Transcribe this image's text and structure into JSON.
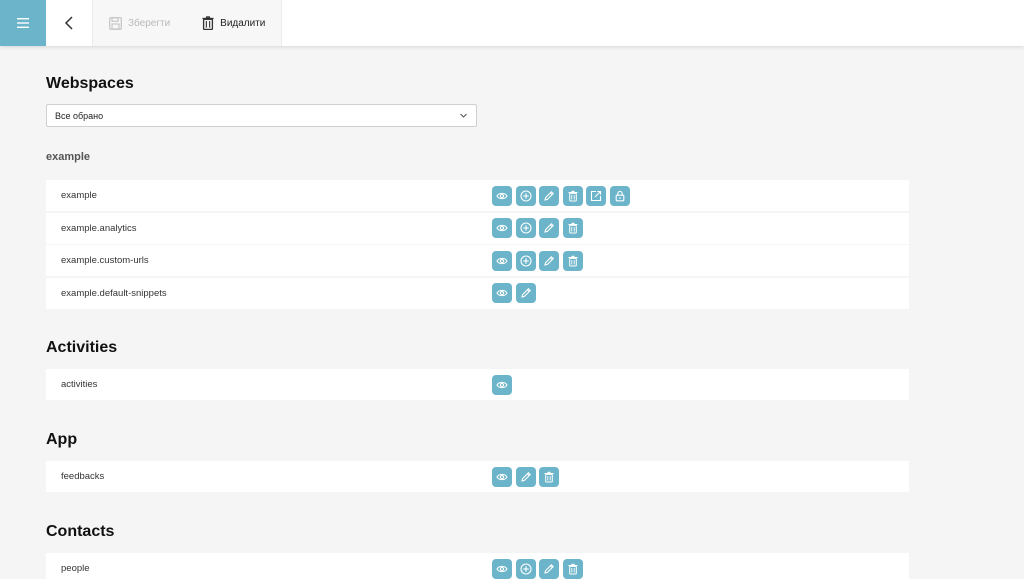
{
  "toolbar": {
    "save_label": "Зберегти",
    "delete_label": "Видалити"
  },
  "colors": {
    "accent": "#6cb4c9",
    "background": "#f5f5f5"
  },
  "webspaces": {
    "title": "Webspaces",
    "select_value": "Все обрано",
    "group_title": "example",
    "rows": [
      {
        "label": "example",
        "icons": [
          "eye-icon",
          "plus-circle-icon",
          "pencil-icon",
          "trash-icon",
          "export-icon",
          "lock-icon"
        ]
      },
      {
        "label": "example.analytics",
        "icons": [
          "eye-icon",
          "plus-circle-icon",
          "pencil-icon",
          "trash-icon"
        ]
      },
      {
        "label": "example.custom-urls",
        "icons": [
          "eye-icon",
          "plus-circle-icon",
          "pencil-icon",
          "trash-icon"
        ]
      },
      {
        "label": "example.default-snippets",
        "icons": [
          "eye-icon",
          "pencil-icon"
        ]
      }
    ]
  },
  "activities": {
    "title": "Activities",
    "rows": [
      {
        "label": "activities",
        "icons": [
          "eye-icon"
        ]
      }
    ]
  },
  "app": {
    "title": "App",
    "rows": [
      {
        "label": "feedbacks",
        "icons": [
          "eye-icon",
          "pencil-icon",
          "trash-icon"
        ]
      }
    ]
  },
  "contacts": {
    "title": "Contacts",
    "rows": [
      {
        "label": "people",
        "icons": [
          "eye-icon",
          "plus-circle-icon",
          "pencil-icon",
          "trash-icon"
        ]
      }
    ]
  }
}
